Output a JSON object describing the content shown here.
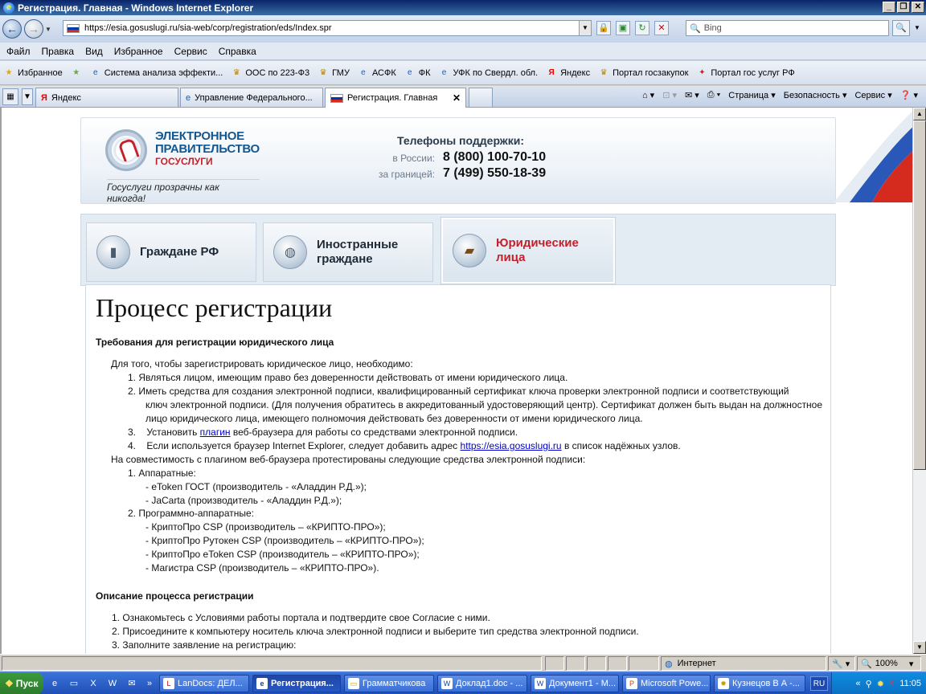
{
  "window": {
    "title": "Регистрация. Главная - Windows Internet Explorer",
    "minimize": "_",
    "maximize": "❐",
    "close": "✕"
  },
  "address": {
    "url": "https://esia.gosuslugi.ru/sia-web/corp/registration/eds/Index.spr",
    "search_placeholder": "Bing"
  },
  "menu": [
    "Файл",
    "Правка",
    "Вид",
    "Избранное",
    "Сервис",
    "Справка"
  ],
  "favorites": {
    "label": "Избранное",
    "items": [
      "Система анализа эффекти...",
      "ООС по 223-Ф3",
      "ГМУ",
      "АСФК",
      "ФК",
      "УФК по Свердл. обл.",
      "Яндекс",
      "Портал госзакупок",
      "Портал гос услуг РФ"
    ]
  },
  "tabs": [
    {
      "label": "Яндекс"
    },
    {
      "label": "Управление Федерального..."
    },
    {
      "label": "Регистрация. Главная"
    }
  ],
  "command_bar": {
    "page": "Страница",
    "safety": "Безопасность",
    "tools": "Сервис"
  },
  "banner": {
    "logo_line1": "ЭЛЕКТРОННОЕ",
    "logo_line2": "ПРАВИТЕЛЬСТВО",
    "logo_line3": "ГОСУСЛУГИ",
    "slogan": "Госуслуги прозрачны как никогда!",
    "support_title": "Телефоны поддержки:",
    "russia_label": "в России:",
    "russia_phone": "8 (800) 100-70-10",
    "abroad_label": "за границей:",
    "abroad_phone": "7 (499) 550-18-39"
  },
  "user_tabs": [
    {
      "label": "Граждане РФ"
    },
    {
      "label_1": "Иностранные",
      "label_2": "граждане"
    },
    {
      "label_1": "Юридические",
      "label_2": "лица"
    }
  ],
  "content": {
    "title": "Процесс регистрации",
    "req_heading": "Требования для регистрации юридического лица",
    "intro": "Для того, чтобы зарегистрировать юридическое лицо, необходимо:",
    "req1": "1.    Являться лицом, имеющим право без доверенности действовать от имени юридического лица.",
    "req2_a": "2.    Иметь средства для создания электронной подписи, квалифицированный сертификат ключа проверки электронной подписи и соответствующий",
    "req2_b": "ключ электронной подписи. (Для получения обратитесь в аккредитованный удостоверяющий центр). Сертификат должен быть выдан на должностное",
    "req2_c": "лицо юридического лица, имеющего полномочия действовать без доверенности от имени юридического лица.",
    "req3_pre": "3.    Установить ",
    "req3_link": "плагин",
    "req3_post": " веб-браузера для работы со средствами электронной подписи.",
    "req4_pre": "4.    Если используется браузер Internet Explorer, следует добавить адрес ",
    "req4_link": "https://esia.gosuslugi.ru",
    "req4_post": " в список надёжных узлов.",
    "compat": "На совместимость с плагином веб-браузера протестированы следующие средства электронной подписи:",
    "hw": "1.    Аппаратные:",
    "hw1": "- eToken ГОСТ (производитель - «Аладдин Р.Д.»);",
    "hw2": "- JaCarta (производитель - «Аладдин Р.Д.»);",
    "sw": "2.    Программно-аппаратные:",
    "sw1": "- КриптоПро CSP (производитель – «КРИПТО-ПРО»);",
    "sw2": "- КриптоПро Рутокен CSP (производитель – «КРИПТО-ПРО»);",
    "sw3": "- КриптоПро eToken CSP (производитель – «КРИПТО-ПРО»);",
    "sw4": "- Магистра CSP (производитель – «КРИПТО-ПРО»).",
    "proc_heading": "Описание процесса регистрации",
    "step1": "1.    Ознакомьтесь с Условиями работы портала и подтвердите свое Согласие с ними.",
    "step2": "2.    Присоедините к компьютеру носитель ключа электронной подписи и выберите тип средства электронной подписи.",
    "step3": "3.    Заполните заявление на регистрацию:"
  },
  "status": {
    "zone": "Интернет",
    "zoom": "100%"
  },
  "taskbar": {
    "start": "Пуск",
    "items": [
      "LanDocs: ДЕЛ...",
      "Регистрация...",
      "Грамматчикова",
      "Доклад1.doc - ...",
      "Документ1 - М...",
      "Microsoft Powe...",
      "Кузнецов В А -..."
    ],
    "lang": "RU",
    "clock": "11:05"
  }
}
